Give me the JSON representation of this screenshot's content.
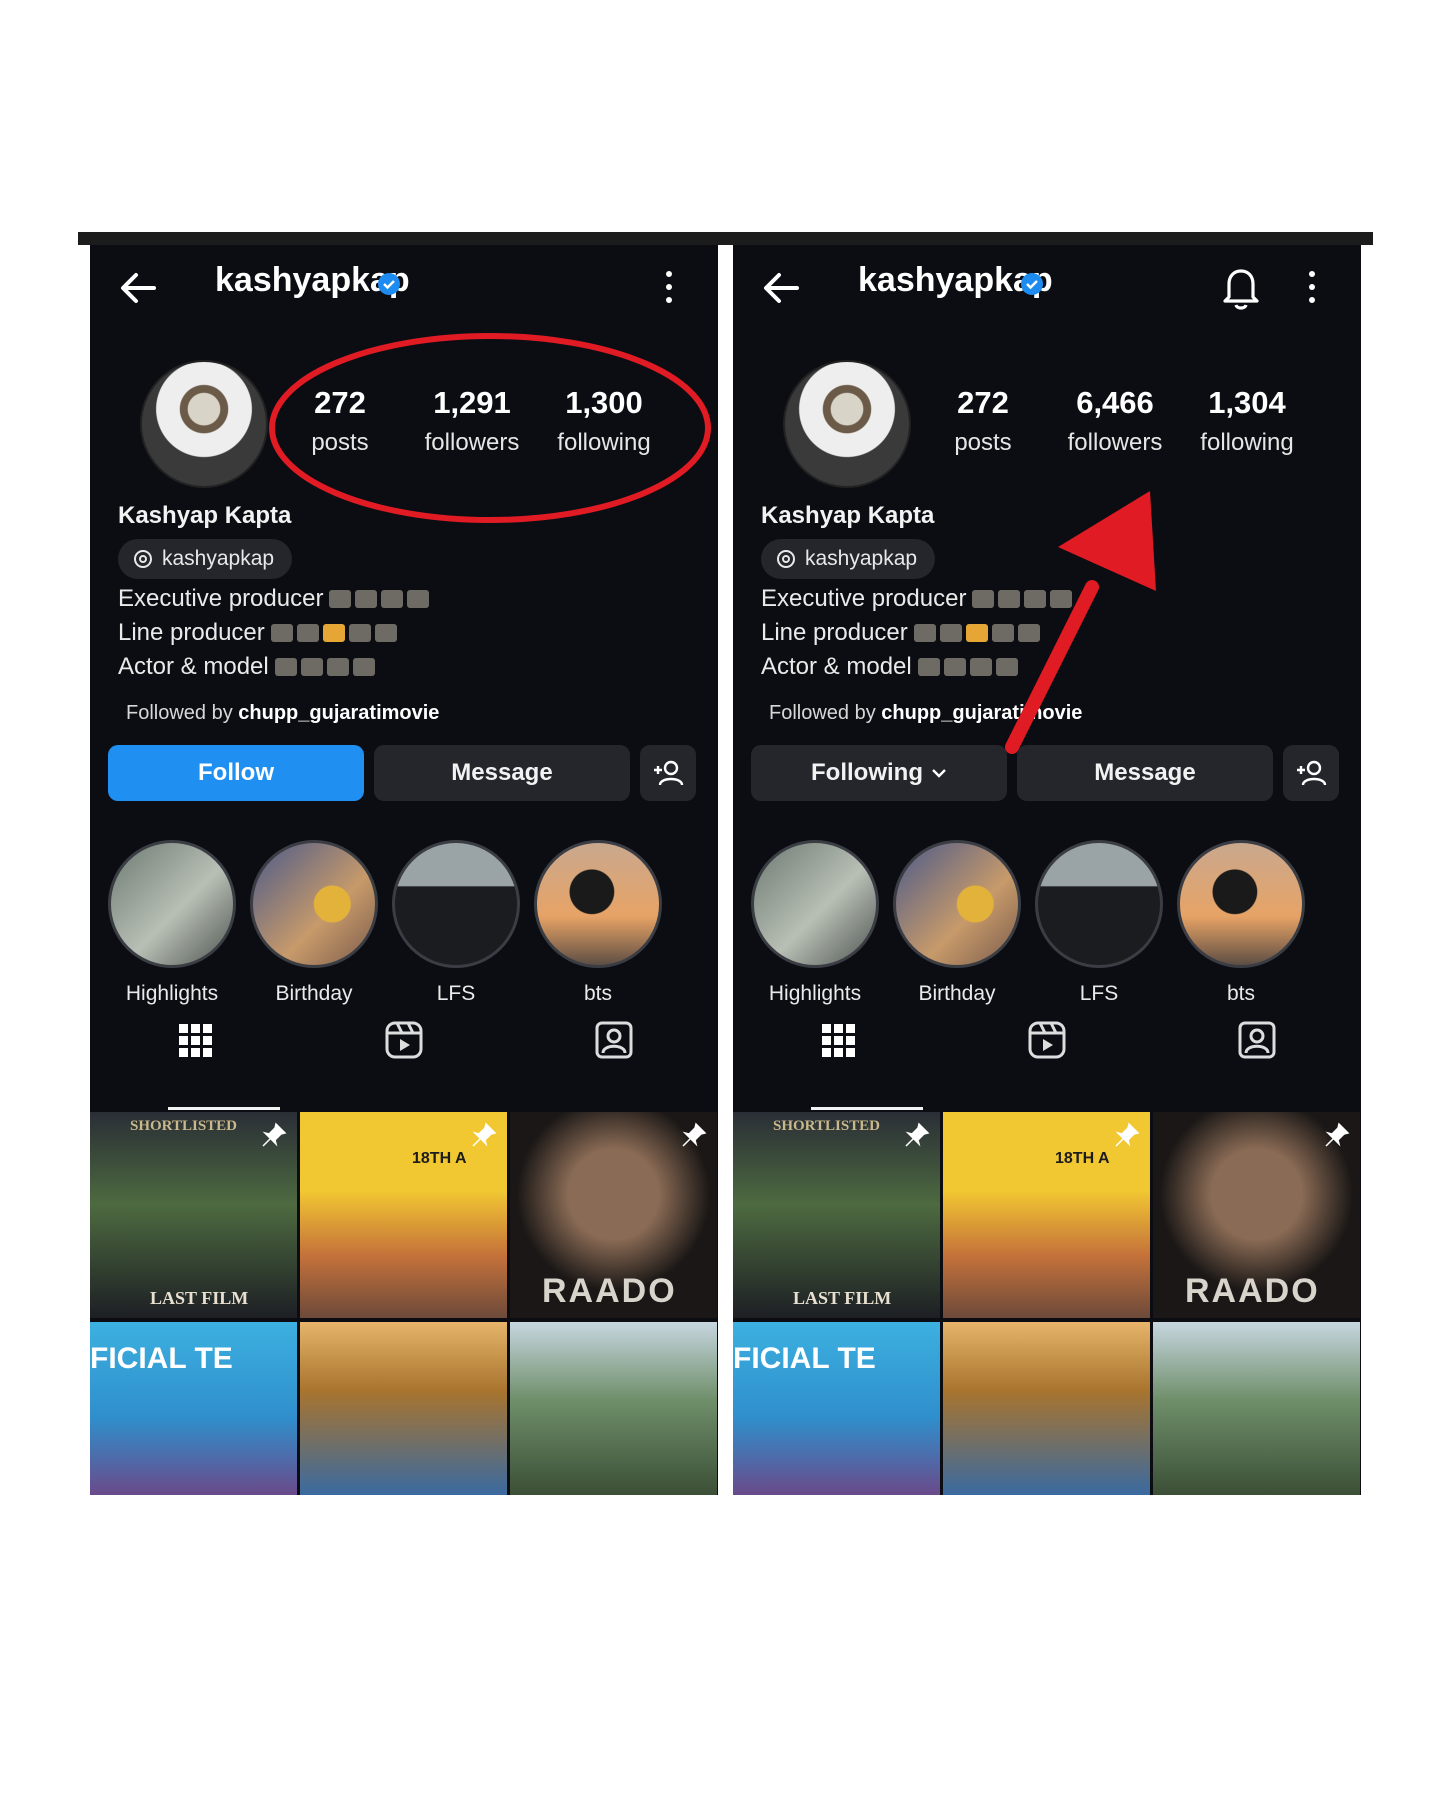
{
  "panels": [
    {
      "id": "left",
      "header": {
        "username": "kashyapkap",
        "show_bell": false
      },
      "stats": [
        {
          "value": "272",
          "label": "posts"
        },
        {
          "value": "1,291",
          "label": "followers"
        },
        {
          "value": "1,300",
          "label": "following"
        }
      ],
      "full_name": "Kashyap Kapta",
      "threads_handle": "kashyapkap",
      "bio": [
        "Executive producer",
        "Line producer",
        "Actor & model"
      ],
      "followed_by_prefix": "Followed by ",
      "followed_by_user": "chupp_gujaratimovie",
      "follow_button": "Follow",
      "message_button": "Message",
      "highlights": [
        "Highlights",
        "Birthday",
        "LFS",
        "bts"
      ]
    },
    {
      "id": "right",
      "header": {
        "username": "kashyapkap",
        "show_bell": true
      },
      "stats": [
        {
          "value": "272",
          "label": "posts"
        },
        {
          "value": "6,466",
          "label": "followers"
        },
        {
          "value": "1,304",
          "label": "following"
        }
      ],
      "full_name": "Kashyap Kapta",
      "threads_handle": "kashyapkap",
      "bio": [
        "Executive producer",
        "Line producer",
        "Actor & model"
      ],
      "followed_by_prefix": "Followed by ",
      "followed_by_user": "chupp_gujaratimovie",
      "follow_button": "Following",
      "message_button": "Message",
      "highlights": [
        "Highlights",
        "Birthday",
        "LFS",
        "bts"
      ]
    }
  ],
  "posts": [
    {
      "text": "SHORTLISTED",
      "subtext": "LAST FILM",
      "pinned": true
    },
    {
      "text": "18TH A",
      "subtext": "",
      "pinned": true
    },
    {
      "text": "RAADO",
      "subtext": "",
      "pinned": true
    },
    {
      "text": "FICIAL TE",
      "subtext": "",
      "pinned": false
    },
    {
      "text": "",
      "subtext": "",
      "pinned": false
    },
    {
      "text": "",
      "subtext": "",
      "pinned": false
    }
  ],
  "colors": {
    "background": "#0c0d12",
    "follow_blue": "#1f8ff2",
    "verified_blue": "#1d8cf0",
    "annotation_red": "#e01b24"
  },
  "icons": [
    "back-arrow-icon",
    "verified-badge-icon",
    "more-options-icon",
    "bell-icon",
    "threads-icon",
    "add-person-icon",
    "chevron-down-icon",
    "grid-icon",
    "reels-icon",
    "tagged-icon",
    "pin-icon"
  ]
}
